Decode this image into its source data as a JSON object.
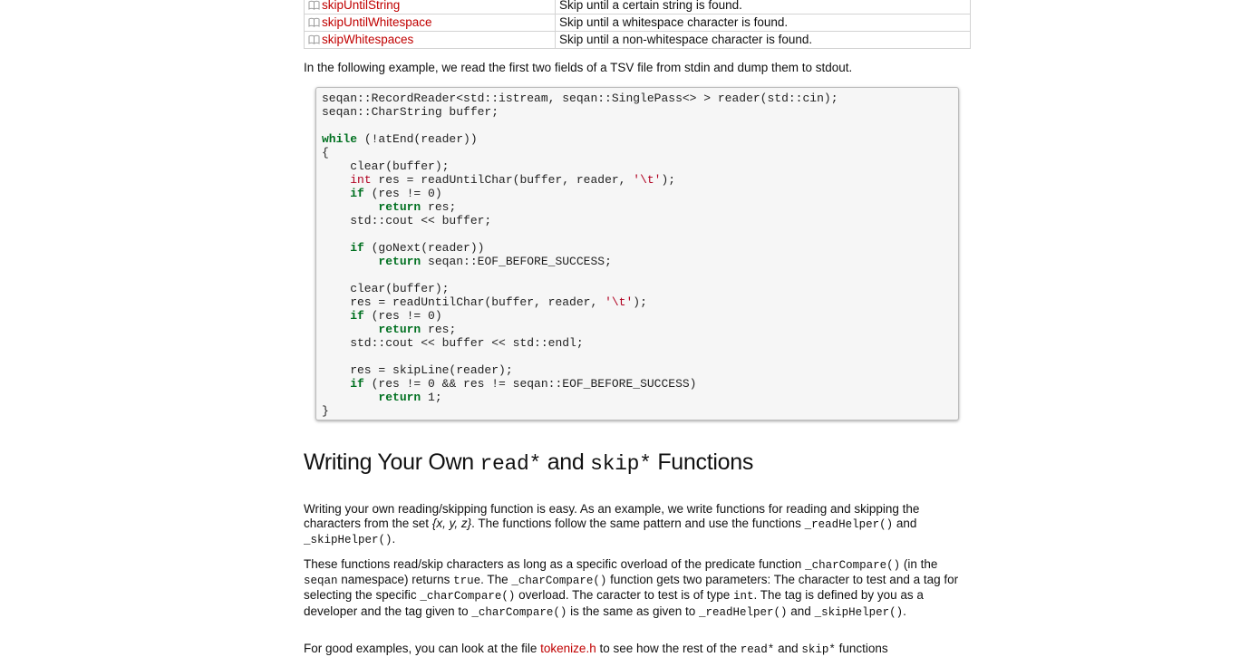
{
  "table_rows": [
    {
      "name": "skipUntilString",
      "desc": "Skip until a certain string is found."
    },
    {
      "name": "skipUntilWhitespace",
      "desc": "Skip until a whitespace character is found."
    },
    {
      "name": "skipWhitespaces",
      "desc": "Skip until a non-whitespace character is found."
    }
  ],
  "intro_text": "In the following example, we read the first two fields of a TSV file from stdin and dump them to stdout.",
  "code_lines": [
    [
      [
        "t",
        "seqan::RecordReader<std::istream, seqan::SinglePass<> > reader(std::cin);"
      ]
    ],
    [
      [
        "t",
        "seqan::CharString buffer;"
      ]
    ],
    [
      [
        "t",
        ""
      ]
    ],
    [
      [
        "k",
        "while"
      ],
      [
        "t",
        " (!atEnd(reader))"
      ]
    ],
    [
      [
        "t",
        "{"
      ]
    ],
    [
      [
        "t",
        "    clear(buffer);"
      ]
    ],
    [
      [
        "t",
        "    "
      ],
      [
        "y",
        "int"
      ],
      [
        "t",
        " res = readUntilChar(buffer, reader, "
      ],
      [
        "s",
        "'\\t'"
      ],
      [
        "t",
        ");"
      ]
    ],
    [
      [
        "t",
        "    "
      ],
      [
        "k",
        "if"
      ],
      [
        "t",
        " (res != 0)"
      ]
    ],
    [
      [
        "t",
        "        "
      ],
      [
        "k",
        "return"
      ],
      [
        "t",
        " res;"
      ]
    ],
    [
      [
        "t",
        "    std::cout << buffer;"
      ]
    ],
    [
      [
        "t",
        ""
      ]
    ],
    [
      [
        "t",
        "    "
      ],
      [
        "k",
        "if"
      ],
      [
        "t",
        " (goNext(reader))"
      ]
    ],
    [
      [
        "t",
        "        "
      ],
      [
        "k",
        "return"
      ],
      [
        "t",
        " seqan::EOF_BEFORE_SUCCESS;"
      ]
    ],
    [
      [
        "t",
        ""
      ]
    ],
    [
      [
        "t",
        "    clear(buffer);"
      ]
    ],
    [
      [
        "t",
        "    res = readUntilChar(buffer, reader, "
      ],
      [
        "s",
        "'\\t'"
      ],
      [
        "t",
        ");"
      ]
    ],
    [
      [
        "t",
        "    "
      ],
      [
        "k",
        "if"
      ],
      [
        "t",
        " (res != 0)"
      ]
    ],
    [
      [
        "t",
        "        "
      ],
      [
        "k",
        "return"
      ],
      [
        "t",
        " res;"
      ]
    ],
    [
      [
        "t",
        "    std::cout << buffer << std::endl;"
      ]
    ],
    [
      [
        "t",
        ""
      ]
    ],
    [
      [
        "t",
        "    res = skipLine(reader);"
      ]
    ],
    [
      [
        "t",
        "    "
      ],
      [
        "k",
        "if"
      ],
      [
        "t",
        " (res != 0 && res != seqan::EOF_BEFORE_SUCCESS)"
      ]
    ],
    [
      [
        "t",
        "        "
      ],
      [
        "k",
        "return"
      ],
      [
        "t",
        " 1;"
      ]
    ],
    [
      [
        "t",
        "}"
      ]
    ]
  ],
  "heading": {
    "part1": "Writing Your Own ",
    "code1": "read*",
    "part2": " and ",
    "code2": "skip*",
    "part3": " Functions"
  },
  "para1": [
    [
      "t",
      "Writing your own reading/skipping function is easy. As an example, we write functions for reading and skipping the characters from the set "
    ],
    [
      "i",
      "{x, y, z}"
    ],
    [
      "t",
      ". The functions follow the same pattern and use the functions "
    ],
    [
      "m",
      "_readHelper()"
    ],
    [
      "t",
      " and "
    ],
    [
      "m",
      "_skipHelper()"
    ],
    [
      "t",
      "."
    ]
  ],
  "para2": [
    [
      "t",
      "These functions read/skip characters as long as a specific overload of the predicate function "
    ],
    [
      "m",
      "_charCompare()"
    ],
    [
      "t",
      " (in the "
    ],
    [
      "m",
      "seqan"
    ],
    [
      "t",
      " namespace) returns "
    ],
    [
      "m",
      "true"
    ],
    [
      "t",
      ". The "
    ],
    [
      "m",
      "_charCompare()"
    ],
    [
      "t",
      " function gets two parameters: The character to test and a tag for selecting the specific "
    ],
    [
      "m",
      "_charCompare()"
    ],
    [
      "t",
      " overload. The caracter to test is of type "
    ],
    [
      "m",
      "int"
    ],
    [
      "t",
      ". The tag is defined by you as a developer and the tag given to "
    ],
    [
      "m",
      "_charCompare()"
    ],
    [
      "t",
      " is the same as given to "
    ],
    [
      "m",
      "_readHelper()"
    ],
    [
      "t",
      " and "
    ],
    [
      "m",
      "_skipHelper()"
    ],
    [
      "t",
      "."
    ]
  ],
  "para3": [
    [
      "t",
      "For good examples, you can look at the file "
    ],
    [
      "l",
      "tokenize.h"
    ],
    [
      "t",
      " to see how the rest of the "
    ],
    [
      "m",
      "read*"
    ],
    [
      "t",
      " and "
    ],
    [
      "m",
      "skip*"
    ],
    [
      "t",
      " functions"
    ]
  ],
  "colors": {
    "link": "#c00000",
    "keyword": "#007020",
    "code_bg": "#f6f6f6"
  }
}
